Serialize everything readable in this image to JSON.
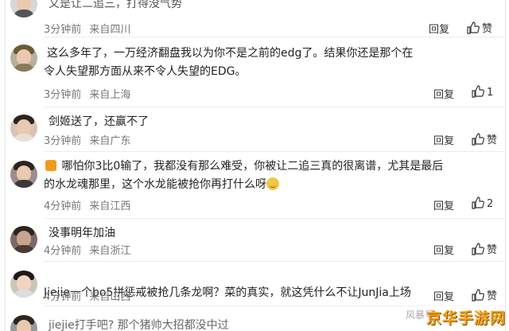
{
  "comments": [
    {
      "username": "",
      "text": "又是让二追三，打得没气势",
      "time": "3分钟前",
      "location": "来自四川",
      "reply": "回复",
      "likes": "赞",
      "avatar_color": "#d7d7d7"
    },
    {
      "username": "",
      "text_line1": "这么多年了，一万经济翻盘我以为你不是之前的edg了。结果你还是那个在",
      "text_line2": "令人失望那方面从来不令人失望的EDG。",
      "time": "3分钟前",
      "location": "来自上海",
      "reply": "回复",
      "likes": "1",
      "avatar_color": "#b8b09a"
    },
    {
      "username": "",
      "text": "剑姬送了，还赢不了",
      "time": "3分钟前",
      "location": "来自广东",
      "reply": "回复",
      "likes": "赞",
      "avatar_color": "#d8c3b5"
    },
    {
      "username": "",
      "text_line1": "哪怕你3比0输了，我都没有那么难受，你被让二追三真的很离谱，尤其是最后",
      "text_line2": "的水龙魂那里，这个水龙能被抢你再打什么呀",
      "time": "4分钟前",
      "location": "来自江西",
      "reply": "回复",
      "likes": "2",
      "avatar_color": "#9a8f8a"
    },
    {
      "username": "",
      "text": "没事明年加油",
      "time": "4分钟前",
      "location": "来自浙江",
      "reply": "回复",
      "likes": "赞",
      "avatar_color": "#7a6a66"
    },
    {
      "username": "",
      "text": "Jiejie一个bo5拼惩戒被抢几条龙啊？菜的真实，就这凭什么不让JunJia上场",
      "time": "4分钟前",
      "location": "来自山西",
      "reply": "回复",
      "likes": "赞",
      "avatar_color": "#cfc4b8"
    },
    {
      "username": "",
      "text": "jiejie打手吧? 那个猪帅大招都没中过",
      "time": "",
      "location": "",
      "reply": "",
      "likes": "",
      "avatar_color": "#999999"
    }
  ],
  "watermark": {
    "small": "风暴号",
    "logo": "京华手游网"
  },
  "colors": {
    "username": "#3a5f9a",
    "meta": "#777777",
    "logo": "#f3a31b"
  }
}
